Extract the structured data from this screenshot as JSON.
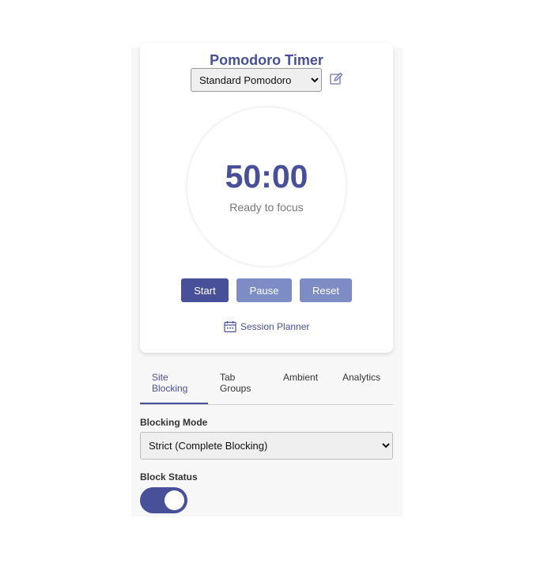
{
  "timer": {
    "title": "Pomodoro Timer",
    "preset": {
      "selected": "Standard Pomodoro",
      "options": [
        "Standard Pomodoro"
      ]
    },
    "time": "50:00",
    "status": "Ready to focus",
    "buttons": {
      "start": "Start",
      "pause": "Pause",
      "reset": "Reset"
    },
    "planner_label": "Session Planner"
  },
  "tabs": [
    {
      "label": "Site\nBlocking",
      "active": true
    },
    {
      "label": "Tab\nGroups",
      "active": false
    },
    {
      "label": "Ambient",
      "active": false
    },
    {
      "label": "Analytics",
      "active": false
    }
  ],
  "blocking": {
    "mode_label": "Blocking Mode",
    "mode": {
      "selected": "Strict (Complete Blocking)",
      "options": [
        "Strict (Complete Blocking)"
      ]
    },
    "status_label": "Block Status",
    "status_on": true
  },
  "colors": {
    "accent": "#48509a",
    "button_secondary": "#7d8cc4",
    "panel_bg": "#f7f7f7"
  },
  "icons": {
    "edit": "edit-icon",
    "calendar": "calendar-icon"
  }
}
